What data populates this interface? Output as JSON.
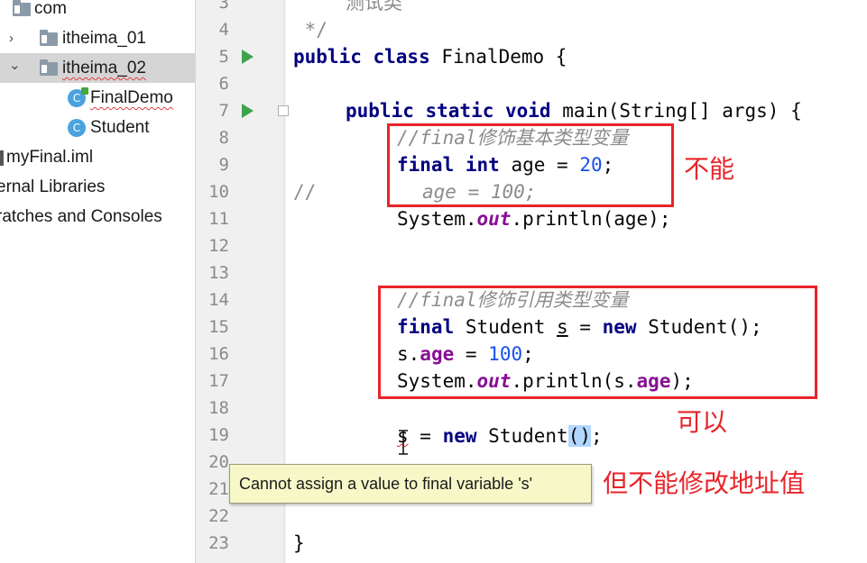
{
  "tree": {
    "items": [
      {
        "label": "com",
        "icon": "folder-icon"
      },
      {
        "label": "itheima_01",
        "icon": "folder-icon",
        "expander": "›"
      },
      {
        "label": "itheima_02",
        "icon": "folder-icon",
        "expander": "⌄"
      },
      {
        "label": "FinalDemo",
        "icon": "class-icon",
        "icon_letter": "C"
      },
      {
        "label": "Student",
        "icon": "class-icon",
        "icon_letter": "C"
      },
      {
        "label": "myFinal.iml",
        "icon": "file-icon"
      },
      {
        "label": "ernal Libraries"
      },
      {
        "label": "ratches and Consoles"
      }
    ]
  },
  "gutter": {
    "line_numbers": [
      "3",
      "4",
      "5",
      "6",
      "7",
      "8",
      "9",
      "10",
      "11",
      "12",
      "13",
      "14",
      "15",
      "16",
      "17",
      "18",
      "19",
      "20",
      "21",
      "22",
      "23"
    ]
  },
  "code": {
    "l3": "测试类",
    "l4": " */",
    "l5_kw": "public class",
    "l5_rest": " FinalDemo {",
    "l7_kw": "public static void",
    "l7_rest": " main(String[] args) {",
    "l8": "//final修饰基本类型变量",
    "l9_kw": "final int",
    "l9_mid": " age = ",
    "l9_num": "20",
    "l9_end": ";",
    "l10_slash": "//",
    "l10_rest": "age = 100;",
    "l11_a": "System.",
    "l11_b": "out",
    "l11_c": ".println(age);",
    "l14": "//final修饰引用类型变量",
    "l15_kw": "final",
    "l15_a": " Student ",
    "l15_s": "s",
    "l15_b": " = ",
    "l15_new": "new",
    "l15_c": " Student();",
    "l16_a": "s.",
    "l16_fld": "age",
    "l16_b": " = ",
    "l16_num": "100",
    "l16_c": ";",
    "l17_a": "System.",
    "l17_b": "out",
    "l17_c": ".println(s.",
    "l17_fld": "age",
    "l17_d": ");",
    "l19_s": "s",
    "l19_a": " = ",
    "l19_new": "new",
    "l19_b": " Student",
    "l19_paren": "()",
    "l19_c": ";",
    "l23": "}"
  },
  "annotations": {
    "cannot": "不能",
    "can": "可以",
    "cannot_modify_address": "但不能修改地址值"
  },
  "tooltip": {
    "text": "Cannot assign a value to final variable 's'"
  },
  "colors": {
    "annotation_red": "#e8242a",
    "keyword": "#000080",
    "number": "#1750eb",
    "comment": "#8c8c8c",
    "field": "#871094",
    "tooltip_bg": "#f7f8c8"
  }
}
